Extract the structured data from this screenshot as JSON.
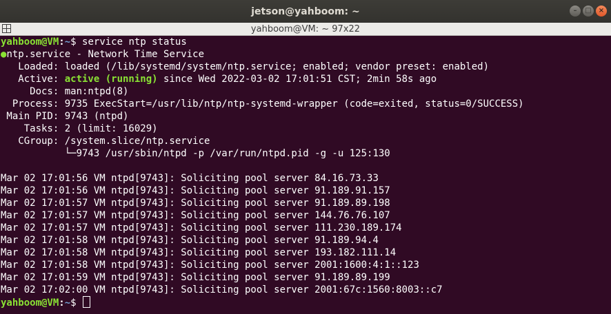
{
  "window": {
    "title": "jetson@yahboom: ~",
    "tab_title": "yahboom@VM: ~ 97x22",
    "buttons": [
      "–",
      "□",
      "×"
    ]
  },
  "terminal": {
    "prompt": {
      "user": "yahboom@VM",
      "sep": ":",
      "path": "~",
      "symbol": "$ "
    },
    "command": "service ntp status",
    "service_header": "ntp.service - Network Time Service",
    "loaded": "   Loaded: loaded (/lib/systemd/system/ntp.service; enabled; vendor preset: enabled)",
    "active_label": "   Active: ",
    "active_state": "active (running)",
    "active_rest": " since Wed 2022-03-02 17:01:51 CST; 2min 58s ago",
    "docs": "     Docs: man:ntpd(8)",
    "process": "  Process: 9735 ExecStart=/usr/lib/ntp/ntp-systemd-wrapper (code=exited, status=0/SUCCESS)",
    "main_pid": " Main PID: 9743 (ntpd)",
    "tasks": "    Tasks: 2 (limit: 16029)",
    "cgroup": "   CGroup: /system.slice/ntp.service",
    "cgroup_child": "           └─9743 /usr/sbin/ntpd -p /var/run/ntpd.pid -g -u 125:130",
    "log_lines": [
      "Mar 02 17:01:56 VM ntpd[9743]: Soliciting pool server 84.16.73.33",
      "Mar 02 17:01:56 VM ntpd[9743]: Soliciting pool server 91.189.91.157",
      "Mar 02 17:01:57 VM ntpd[9743]: Soliciting pool server 91.189.89.198",
      "Mar 02 17:01:57 VM ntpd[9743]: Soliciting pool server 144.76.76.107",
      "Mar 02 17:01:57 VM ntpd[9743]: Soliciting pool server 111.230.189.174",
      "Mar 02 17:01:58 VM ntpd[9743]: Soliciting pool server 91.189.94.4",
      "Mar 02 17:01:58 VM ntpd[9743]: Soliciting pool server 193.182.111.14",
      "Mar 02 17:01:58 VM ntpd[9743]: Soliciting pool server 2001:1600:4:1::123",
      "Mar 02 17:01:59 VM ntpd[9743]: Soliciting pool server 91.189.89.199",
      "Mar 02 17:02:00 VM ntpd[9743]: Soliciting pool server 2001:67c:1560:8003::c7"
    ]
  },
  "colors": {
    "background": "#300a24",
    "prompt_user": "#8ae234",
    "prompt_path": "#729fcf",
    "active": "#8ae234"
  }
}
